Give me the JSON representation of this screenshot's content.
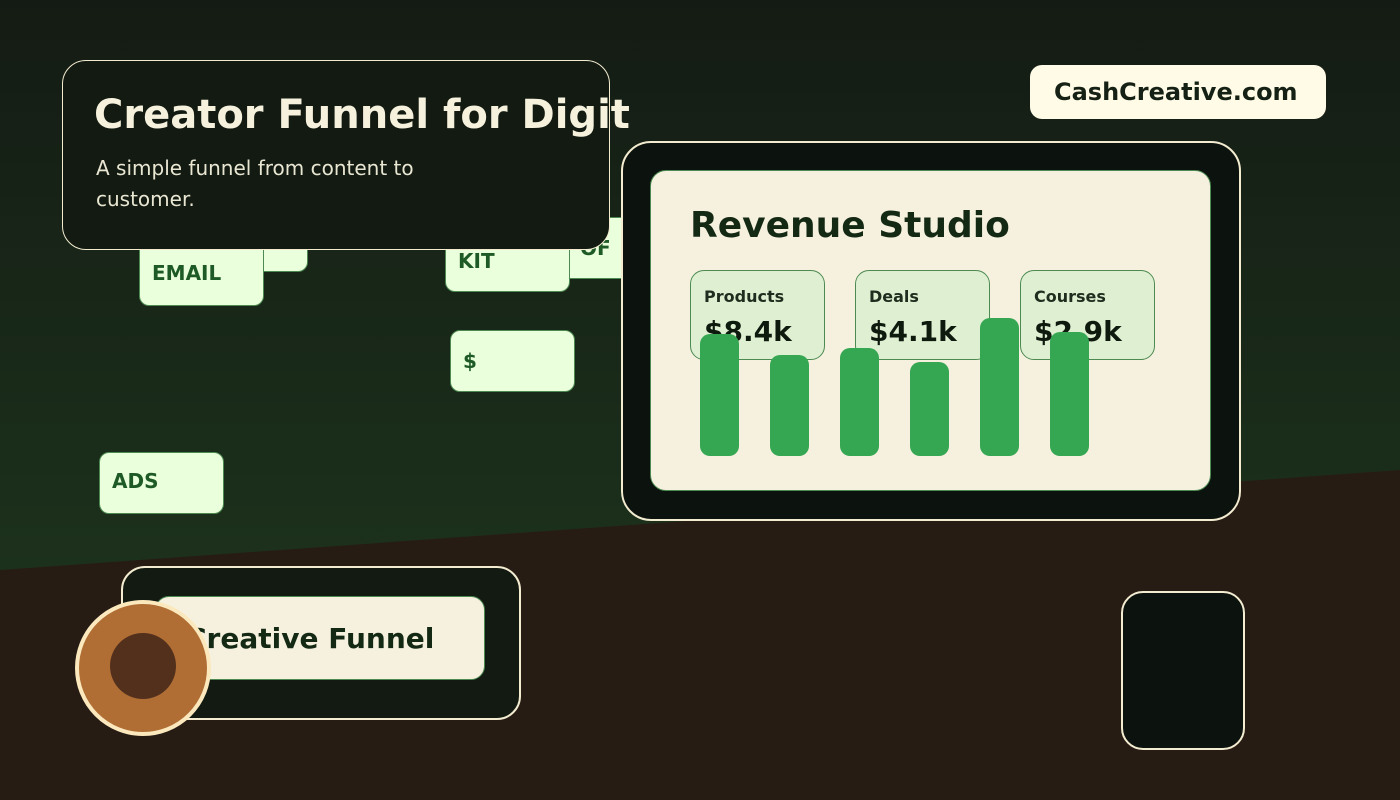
{
  "header": {
    "title": "Creator Funnel for Digit",
    "subtitle": "A simple funnel from content to customer."
  },
  "brand": {
    "label": "CashCreative.com"
  },
  "funnel_chips": {
    "email": "EMAIL",
    "kit": "KIT",
    "offer_partial": "OF",
    "dollar": "$",
    "ads": "ADS",
    "hidden": ""
  },
  "dashboard": {
    "title": "Revenue Studio",
    "stats": [
      {
        "label": "Products",
        "value": "$8.4k"
      },
      {
        "label": "Deals",
        "value": "$4.1k"
      },
      {
        "label": "Courses",
        "value": "$2.9k"
      }
    ]
  },
  "chart_data": {
    "type": "bar",
    "categories": [],
    "values": [
      122,
      101,
      108,
      94,
      138,
      124
    ],
    "ylim": [
      0,
      140
    ],
    "title": "",
    "xlabel": "",
    "ylabel": "",
    "grid": false,
    "colors": {
      "bar": "#35a652"
    }
  },
  "footer": {
    "label": "Creative Funnel"
  },
  "colors": {
    "accent": "#35a652",
    "chip_bg": "#eaffdb",
    "cream": "#f6f1df",
    "avatar": "#b06e35"
  }
}
